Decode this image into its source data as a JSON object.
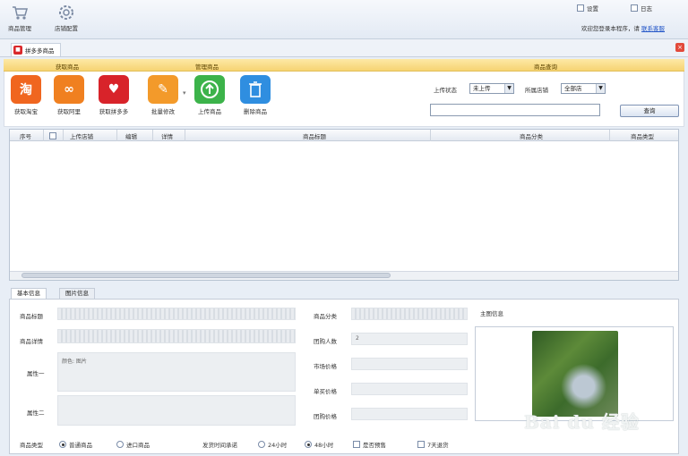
{
  "toolbar": {
    "items": [
      {
        "label": "商品管理",
        "icon": "cart-icon"
      },
      {
        "label": "店铺配置",
        "icon": "gear-icon"
      }
    ],
    "right_check_1": "设置",
    "right_check_2": "日志"
  },
  "welcome": {
    "text": "欢迎您登录本程序，请",
    "link": "联系客服"
  },
  "main_tab": {
    "label": "拼多多商品"
  },
  "ribbon": {
    "group_fetch": "获取商品",
    "group_manage": "管理商品",
    "group_query": "商品查询",
    "buttons": [
      {
        "label": "获取淘宝",
        "icon": "taobao-icon",
        "glyph": "淘",
        "color": "#f0661f"
      },
      {
        "label": "获取阿里",
        "icon": "alibaba-icon",
        "glyph": "∞",
        "color": "#f08020"
      },
      {
        "label": "获取拼多多",
        "icon": "pinduoduo-icon",
        "glyph": "♥",
        "color": "#d8232a"
      },
      {
        "label": "批量修改",
        "icon": "pencil-icon",
        "glyph": "✎",
        "color": "#f39a2a"
      },
      {
        "label": "上传商品",
        "icon": "upload-icon",
        "glyph": "↑",
        "color": "#3cb34a"
      },
      {
        "label": "删除商品",
        "icon": "trash-icon",
        "glyph": "🗑",
        "color": "#2f8ee0"
      }
    ],
    "status_label": "上传状态",
    "status_value": "未上传",
    "store_label": "所属店铺",
    "store_value": "全部店",
    "search_value": "",
    "search_button": "查询"
  },
  "grid": {
    "headers": [
      "序号",
      "",
      "上传店铺",
      "编辑",
      "详情",
      "商品标题",
      "商品分类",
      "商品类型"
    ]
  },
  "bottom_tabs": [
    "基本信息",
    "图片信息"
  ],
  "form": {
    "title_label": "商品标题",
    "detail_label": "商品详情",
    "attr1_label": "属性一",
    "attr2_label": "属性二",
    "attr1_value": "颜色: 图片",
    "category_label": "商品分类",
    "group_count_label": "团购人数",
    "group_count_value": "2",
    "market_price_label": "市场价格",
    "single_price_label": "单买价格",
    "group_price_label": "团购价格",
    "image_section": "主图信息",
    "type_label": "商品类型",
    "type_opt1": "普通商品",
    "type_opt2": "进口商品",
    "ship_label": "发货时间承诺",
    "ship_opt1": "24小时",
    "ship_opt2": "48小时",
    "preorder": "是否预售",
    "seven_day": "7天退货"
  },
  "watermark": "Bai du 经验"
}
